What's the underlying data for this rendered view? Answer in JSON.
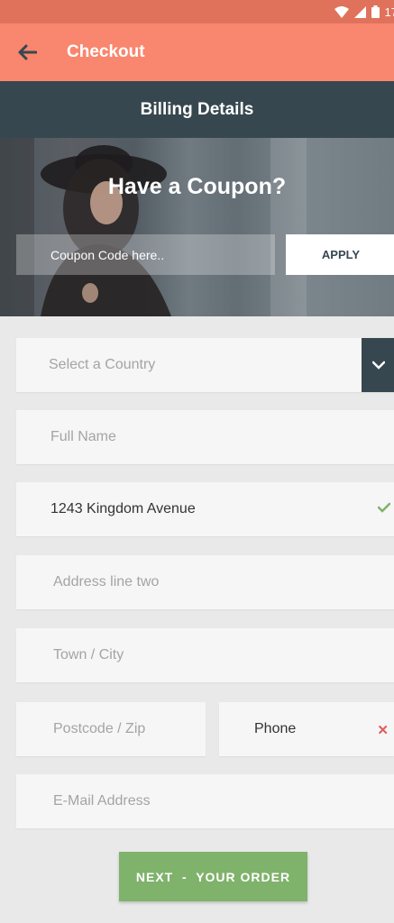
{
  "status_bar": {
    "time": "17"
  },
  "app_bar": {
    "title": "Checkout"
  },
  "section": {
    "title": "Billing Details"
  },
  "coupon": {
    "heading": "Have a Coupon?",
    "placeholder": "Coupon Code here..",
    "apply_label": "APPLY"
  },
  "form": {
    "country": {
      "placeholder": "Select a Country"
    },
    "full_name": {
      "placeholder": "Full Name"
    },
    "address_line_one": {
      "value": "1243 Kingdom Avenue",
      "status": "valid"
    },
    "address_line_two": {
      "placeholder": "Address line two"
    },
    "town_city": {
      "placeholder": "Town / City"
    },
    "postcode": {
      "placeholder": "Postcode / Zip"
    },
    "phone": {
      "value": "Phone",
      "status": "invalid"
    },
    "email": {
      "placeholder": "E-Mail Address"
    }
  },
  "next_button": {
    "label": "NEXT  -  YOUR ORDER"
  },
  "colors": {
    "app_bar": "#f9866e",
    "section_bar": "#37474f",
    "next_button": "#7fb26b",
    "valid_check": "#7fb26b",
    "invalid_mark": "#e35b5b"
  },
  "icons": [
    "back-arrow-icon",
    "wifi-icon",
    "signal-icon",
    "battery-icon",
    "chevron-down-icon",
    "check-icon",
    "close-icon"
  ]
}
